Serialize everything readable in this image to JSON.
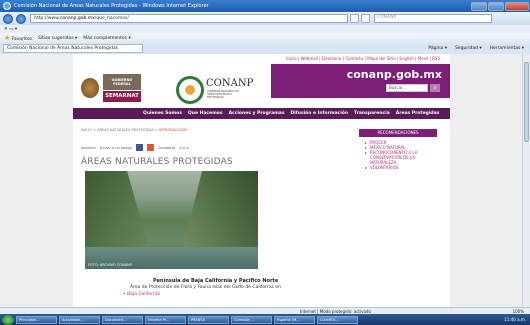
{
  "browser": {
    "title": "Comisión Nacional de Áreas Naturales Protegidas - Windows Internet Explorer",
    "url_prefix": "http://www.",
    "url_host": "conanp.gob.mx",
    "url_path": "/que_hacemos/",
    "search_placeholder": "CONANP",
    "favorites_label": "Favoritos",
    "suggested_sites": "Sitios sugeridos ▾",
    "more_addons": "Más complementos ▾",
    "tab_label": "Comisión Nacional de Áreas Naturales Protegidas",
    "tool_menus": [
      "Página ▾",
      "Seguridad ▾",
      "Herramientas ▾"
    ]
  },
  "page": {
    "top_links": "Inicio | Webmail | Directorio | Contacto | Mapa del Sitio | English | Movil | RSS",
    "gob_label": "GOBIERNO FEDERAL",
    "semarnat": "SEMARNAT",
    "brand": "CONANP",
    "brand_sub": "COMISIÓN NACIONAL DE ÁREAS NATURALES PROTEGIDAS",
    "domain": "conanp.gob.mx",
    "search_placeholder": "Buscar...",
    "search_button": "ir",
    "nav": [
      "Quienes Somos",
      "Que Hacemos",
      "Acciones y Programas",
      "Difusión e Información",
      "Transparencia",
      "Áreas Protegidas"
    ],
    "breadcrumb_prefix": "INICIO > ÁREAS NATURALES PROTEGIDAS > ",
    "breadcrumb_current": "INTRODUCCIÓN",
    "action_print": "Imprimir",
    "action_send": "Enviar a un amigo",
    "action_share": "Compartir",
    "title": "ÁREAS NATURALES PROTEGIDAS",
    "photo_credit": "FOTO: ARCHIVO CONANP",
    "region": "Península de Baja California y Pacífico Norte",
    "area_desc": "Área de Protección de Flora y Fauna Islas del Golfo de California en",
    "area_link": "Baja California",
    "sidebar_title": "RECOMENDACIONES",
    "sidebar_items": [
      "PROCER",
      "MÉXICO NATURAL",
      "RECONOCIMIENTO A LA CONSERVACIÓN DE LA NATURALEZA",
      "VOLUNTARIOS"
    ]
  },
  "status": {
    "zone": "Internet | Modo protegido: activado",
    "zoom": "100%"
  },
  "taskbar": {
    "tasks": [
      "Principale...",
      "Actividade...",
      "Document...",
      "Informe Pr...",
      "PRENSA",
      "Comisión ...",
      "Español (M...",
      "COntROL..."
    ],
    "clock": "11:40 a.m."
  }
}
